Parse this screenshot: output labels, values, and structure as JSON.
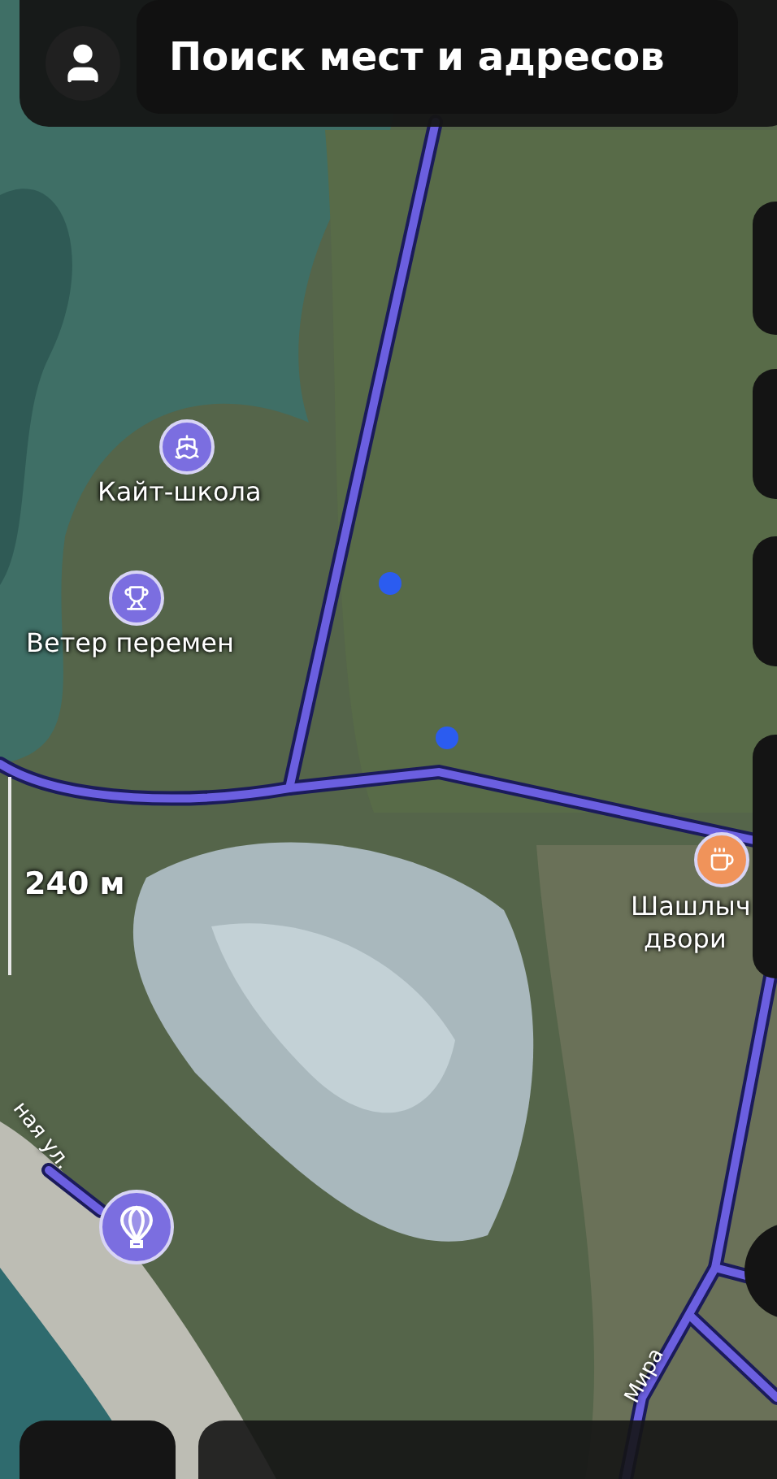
{
  "search": {
    "placeholder": "Поиск мест и адресов"
  },
  "map": {
    "scale": "240 м",
    "places": [
      {
        "kind": "boat",
        "lines": [
          "Кайт-школа"
        ],
        "color": "#7b6ee0"
      },
      {
        "kind": "trophy",
        "lines": [
          "Ветер перемен"
        ],
        "color": "#7b6ee0"
      },
      {
        "kind": "cafe",
        "lines": [
          "Шашлыч",
          "двори"
        ],
        "color": "#f0935a"
      },
      {
        "kind": "balloon",
        "color": "#7b6ee0"
      }
    ],
    "streets": [
      "ная ул.",
      "Мира"
    ]
  }
}
